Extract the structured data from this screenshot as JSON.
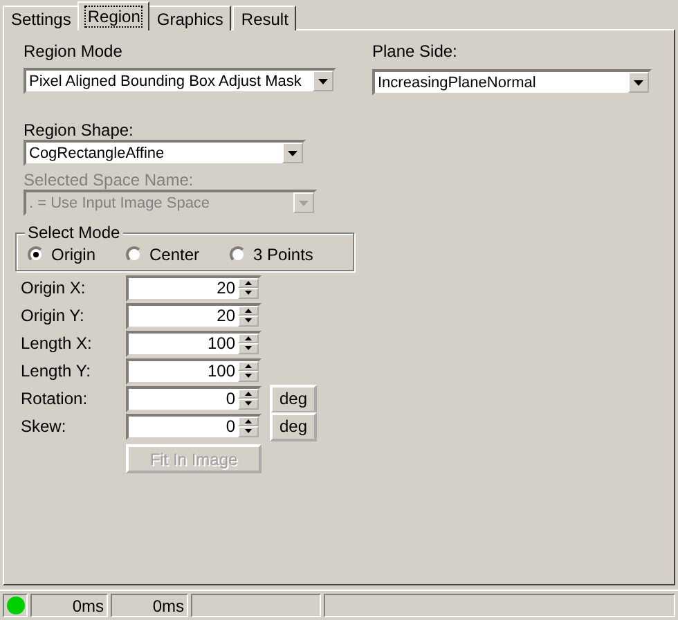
{
  "tabs": [
    {
      "label": "Settings",
      "selected": false
    },
    {
      "label": "Region",
      "selected": true
    },
    {
      "label": "Graphics",
      "selected": false
    },
    {
      "label": "Result",
      "selected": false
    }
  ],
  "region_mode": {
    "label": "Region Mode",
    "value": "Pixel Aligned Bounding Box Adjust Mask"
  },
  "plane_side": {
    "label": "Plane Side:",
    "value": "IncreasingPlaneNormal"
  },
  "region_shape": {
    "label": "Region Shape:",
    "value": "CogRectangleAffine"
  },
  "selected_space": {
    "label": "Selected Space Name:",
    "value": ". = Use Input Image Space",
    "disabled": true
  },
  "select_mode": {
    "label": "Select Mode",
    "options": [
      {
        "label": "Origin",
        "selected": true
      },
      {
        "label": "Center",
        "selected": false
      },
      {
        "label": "3 Points",
        "selected": false
      }
    ]
  },
  "fields": [
    {
      "label": "Origin X:",
      "value": "20"
    },
    {
      "label": "Origin Y:",
      "value": "20"
    },
    {
      "label": "Length X:",
      "value": "100"
    },
    {
      "label": "Length Y:",
      "value": "100"
    },
    {
      "label": "Rotation:",
      "value": "0",
      "unit": "deg"
    },
    {
      "label": "Skew:",
      "value": "0",
      "unit": "deg"
    }
  ],
  "fit_button": {
    "label": "Fit In Image",
    "disabled": true
  },
  "status_bar": {
    "connected": true,
    "times": [
      "0ms",
      "0ms"
    ]
  }
}
